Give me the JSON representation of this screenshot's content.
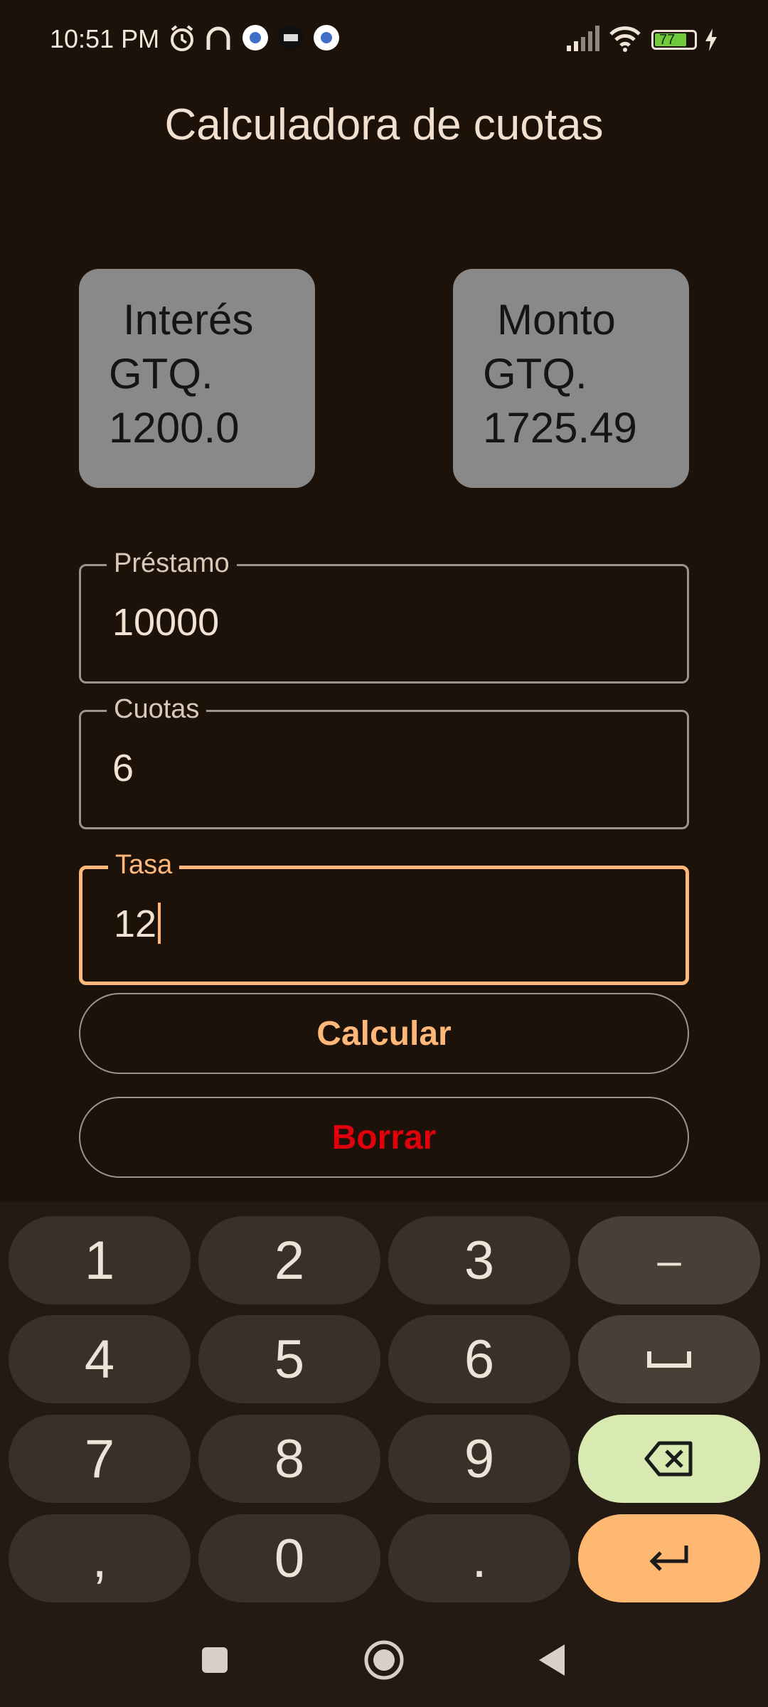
{
  "status": {
    "time": "10:51 PM",
    "battery": "77"
  },
  "app": {
    "title": "Calculadora de cuotas"
  },
  "cards": [
    {
      "line1": "Interés",
      "line2": "GTQ.",
      "line3": "1200.0"
    },
    {
      "line1": "Monto",
      "line2": "GTQ.",
      "line3": "1725.49"
    }
  ],
  "fields": {
    "prestamo": {
      "label": "Préstamo",
      "value": "10000"
    },
    "cuotas": {
      "label": "Cuotas",
      "value": "6"
    },
    "tasa": {
      "label": "Tasa",
      "value": "12"
    }
  },
  "buttons": {
    "calcular": "Calcular",
    "borrar": "Borrar"
  },
  "colors": {
    "accent": "#ffb77a",
    "danger": "#e0000c",
    "card": "#898989",
    "background": "#1d1209"
  },
  "keyboard": {
    "keys": [
      "1",
      "2",
      "3",
      "–",
      "4",
      "5",
      "6",
      "␣",
      "7",
      "8",
      "9",
      "⌫",
      ",",
      "0",
      ".",
      "↵"
    ]
  }
}
